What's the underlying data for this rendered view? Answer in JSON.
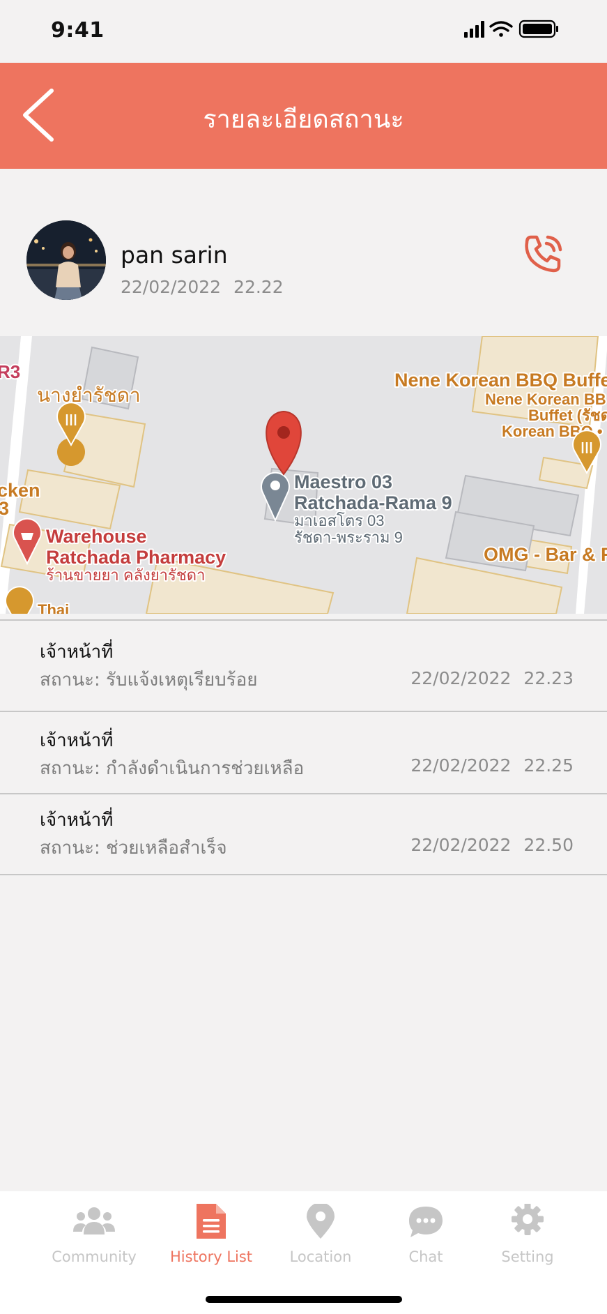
{
  "status_bar": {
    "time": "9:41"
  },
  "header": {
    "title": "รายละเอียดสถานะ",
    "back_icon": "chevron-left-icon"
  },
  "profile": {
    "name": "pan sarin",
    "date": "22/02/2022",
    "time": "22.22",
    "call_icon": "phone-call-icon"
  },
  "map": {
    "labels": {
      "r3": "R3",
      "nang_yam": "นางยำรัชดา",
      "nene_title": "Nene Korean BBQ Buffe",
      "nene_line1": "Nene Korean BB",
      "nene_line2": "Buffet (รัชด",
      "nene_line3": "Korean BBQ •",
      "cken": "cken",
      "num3": "3",
      "maestro_line1": "Maestro 03",
      "maestro_line2": "Ratchada-Rama 9",
      "maestro_th1": "มาเอสโตร 03",
      "maestro_th2": "รัชดา-พระราม 9",
      "warehouse_line1": "Warehouse",
      "warehouse_line2": "Ratchada Pharmacy",
      "warehouse_th": "ร้านขายยา คลังยารัชดา",
      "omg": "OMG - Bar & F",
      "thai": "Thai"
    }
  },
  "status_updates": [
    {
      "title": "เจ้าหน้าที่",
      "status": "สถานะ: รับแจ้งเหตุเรียบร้อย",
      "date": "22/02/2022",
      "time": "22.23"
    },
    {
      "title": "เจ้าหน้าที่",
      "status": "สถานะ: กำลังดำเนินการช่วยเหลือ",
      "date": "22/02/2022",
      "time": "22.25"
    },
    {
      "title": "เจ้าหน้าที่",
      "status": "สถานะ: ช่วยเหลือสำเร็จ",
      "date": "22/02/2022",
      "time": "22.50"
    }
  ],
  "tab_bar": {
    "active": "History List",
    "tabs": [
      {
        "label": "Community",
        "icon": "community-icon"
      },
      {
        "label": "History List",
        "icon": "document-icon"
      },
      {
        "label": "Location",
        "icon": "location-pin-icon"
      },
      {
        "label": "Chat",
        "icon": "chat-bubble-icon"
      },
      {
        "label": "Setting",
        "icon": "gear-icon"
      }
    ]
  },
  "colors": {
    "accent": "#ee745f",
    "background": "#f3f2f2",
    "inactive_tab": "#c6c6c6"
  }
}
